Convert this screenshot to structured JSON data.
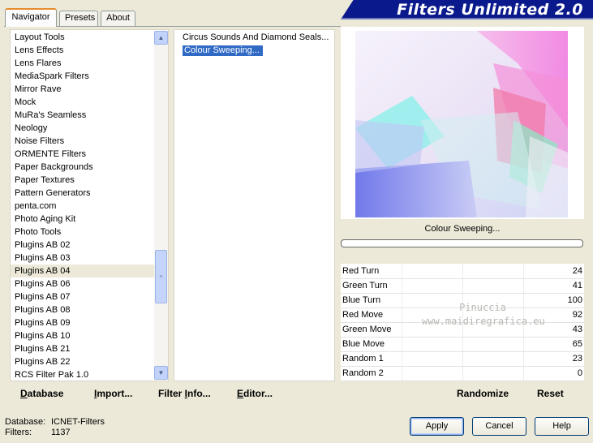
{
  "tabs": [
    "Navigator",
    "Presets",
    "About"
  ],
  "banner_title": "Filters Unlimited 2.0",
  "categories": [
    "Layout Tools",
    "Lens Effects",
    "Lens Flares",
    "MediaSpark Filters",
    "Mirror Rave",
    "Mock",
    "MuRa's Seamless",
    "Neology",
    "Noise Filters",
    "ORMENTE Filters",
    "Paper Backgrounds",
    "Paper Textures",
    "Pattern Generators",
    "penta.com",
    "Photo Aging Kit",
    "Photo Tools",
    "Plugins AB 02",
    "Plugins AB 03",
    "Plugins AB 04",
    "Plugins AB 06",
    "Plugins AB 07",
    "Plugins AB 08",
    "Plugins AB 09",
    "Plugins AB 10",
    "Plugins AB 21",
    "Plugins AB 22",
    "RCS Filter Pak 1.0"
  ],
  "filters": [
    "Circus Sounds And Diamond Seals...",
    "Colour Sweeping..."
  ],
  "filter_name_label": "Colour Sweeping...",
  "parameters": [
    {
      "label": "Red Turn",
      "value": "24"
    },
    {
      "label": "Green Turn",
      "value": "41"
    },
    {
      "label": "Blue Turn",
      "value": "100"
    },
    {
      "label": "Red Move",
      "value": "92"
    },
    {
      "label": "Green Move",
      "value": "43"
    },
    {
      "label": "Blue Move",
      "value": "65"
    },
    {
      "label": "Random 1",
      "value": "23"
    },
    {
      "label": "Random 2",
      "value": "0"
    }
  ],
  "watermark": {
    "line1": "Pinuccia",
    "line2": "www.maidiregrafica.eu"
  },
  "toolbar": {
    "database": {
      "u": "D",
      "rest": "atabase"
    },
    "import": {
      "u": "I",
      "rest": "mport..."
    },
    "filter_info": {
      "pre": "Filter ",
      "u": "I",
      "rest": "nfo..."
    },
    "editor": {
      "u": "E",
      "rest": "ditor..."
    },
    "randomize": "Randomize",
    "reset": "Reset"
  },
  "status": {
    "db_label": "Database:",
    "db_value": "ICNET-Filters",
    "filters_label": "Filters:",
    "filters_value": "1137"
  },
  "buttons": {
    "apply": "Apply",
    "cancel": "Cancel",
    "help": "Help"
  },
  "colors": {
    "selection": "#316ac5",
    "banner": "#0a1a8c",
    "tab_accent": "#e68b2c"
  }
}
